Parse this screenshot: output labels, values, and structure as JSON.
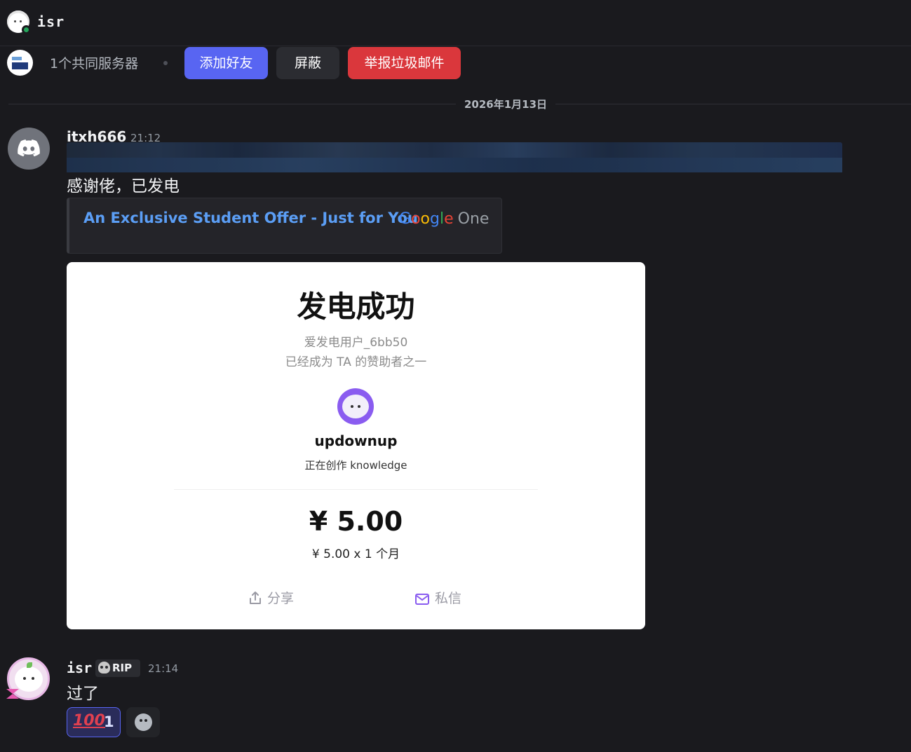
{
  "topbar": {
    "username": "isr",
    "status": "online"
  },
  "profile": {
    "mutual_servers": "1个共同服务器",
    "add_friend": "添加好友",
    "block": "屏蔽",
    "report_spam": "举报垃圾邮件"
  },
  "date_divider": "2026年1月13日",
  "message1": {
    "author": "itxh666",
    "time": "21:12",
    "text": "感谢佬，已发电",
    "embed": {
      "title": "An Exclusive Student Offer - Just for You",
      "brand_letters": [
        "G",
        "o",
        "o",
        "g",
        "l",
        "e"
      ],
      "brand_suffix": "One"
    }
  },
  "card": {
    "title": "发电成功",
    "user": "爱发电用户_6bb50",
    "subtitle": "已经成为 TA 的赞助者之一",
    "creator_name": "updownup",
    "creator_desc": "正在创作 knowledge",
    "price": "¥ 5.00",
    "price_detail": "¥ 5.00 x 1 个月",
    "share_label": "分享",
    "dm_label": "私信"
  },
  "message2": {
    "author": "isr",
    "role_tag": "RIP",
    "time": "21:14",
    "text": "过了",
    "reaction": {
      "emoji": "100",
      "count": "1"
    }
  },
  "colors": {
    "accent": "#5865f2",
    "danger": "#da373c",
    "online": "#23a55a",
    "link": "#5b9ef5"
  }
}
